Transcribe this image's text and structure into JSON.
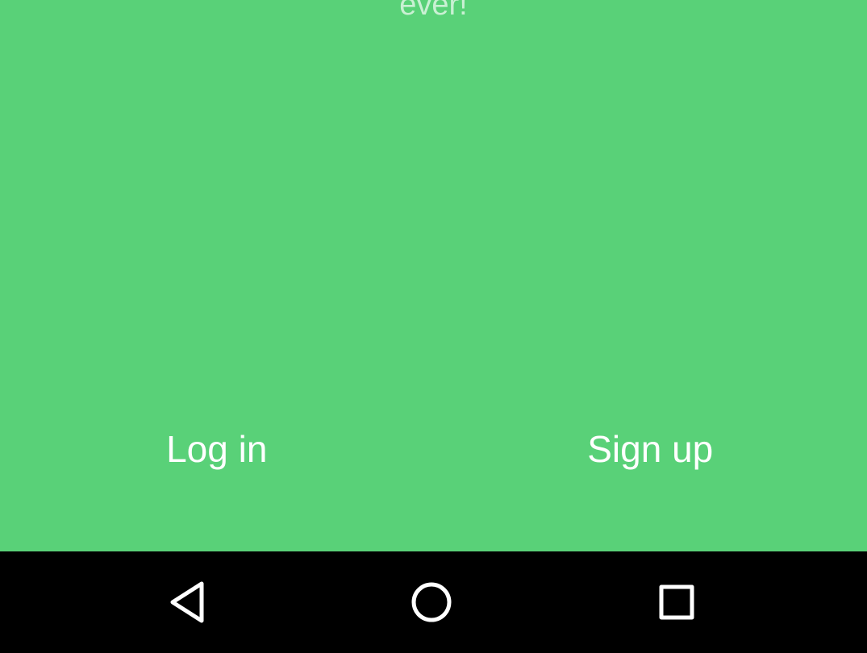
{
  "onboarding": {
    "tagline_fragment": "ever!",
    "login_label": "Log in",
    "signup_label": "Sign up"
  },
  "navigation_bar": {
    "buttons": [
      {
        "name": "back",
        "icon": "back-triangle-icon"
      },
      {
        "name": "home",
        "icon": "home-circle-icon"
      },
      {
        "name": "recents",
        "icon": "recents-square-icon"
      }
    ]
  },
  "colors": {
    "background": "#59d178",
    "tagline_text": "#c9f0d3",
    "button_text": "#ffffff",
    "navbar": "#000000",
    "nav_icons": "#ffffff"
  }
}
